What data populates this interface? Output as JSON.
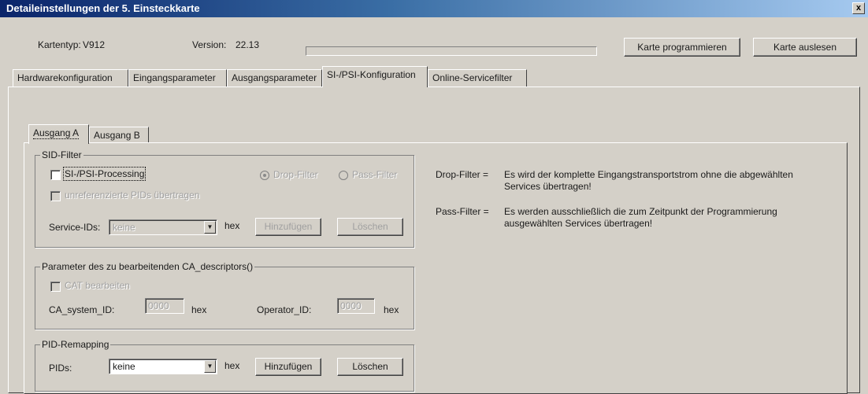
{
  "window": {
    "title": "Detaileinstellungen der 5. Einsteckkarte",
    "close_label": "x"
  },
  "header": {
    "kartentyp_label": "Kartentyp:",
    "kartentyp_value": "V912",
    "version_label": "Version:",
    "version_value": "22.13",
    "program_button": "Karte programmieren",
    "read_button": "Karte auslesen"
  },
  "main_tabs": [
    {
      "label": "Hardwarekonfiguration"
    },
    {
      "label": "Eingangsparameter"
    },
    {
      "label": "Ausgangsparameter"
    },
    {
      "label": "SI-/PSI-Konfiguration"
    },
    {
      "label": "Online-Servicefilter"
    }
  ],
  "sub_tabs": [
    {
      "label": "Ausgang A"
    },
    {
      "label": "Ausgang B"
    }
  ],
  "sid_filter": {
    "legend": "SID-Filter",
    "si_psi_processing": "SI-/PSI-Processing",
    "drop_filter": "Drop-Filter",
    "pass_filter": "Pass-Filter",
    "unreferenced_pids": "unreferenzierte PIDs übertragen",
    "service_ids_label": "Service-IDs:",
    "service_ids_value": "keine",
    "hex": "hex",
    "add_button": "Hinzufügen",
    "delete_button": "Löschen"
  },
  "ca_descriptor": {
    "legend": "Parameter des zu bearbeitenden CA_descriptors()",
    "cat_edit": "CAT bearbeiten",
    "ca_system_id_label": "CA_system_ID:",
    "ca_system_id_value": "0000",
    "operator_id_label": "Operator_ID:",
    "operator_id_value": "0000",
    "hex": "hex"
  },
  "pid_remapping": {
    "legend": "PID-Remapping",
    "pids_label": "PIDs:",
    "pids_value": "keine",
    "hex": "hex",
    "add_button": "Hinzufügen",
    "delete_button": "Löschen"
  },
  "help": {
    "drop_label": "Drop-Filter =",
    "drop_text_1": "Es wird der komplette Eingangstransportstrom ohne die abgewählten",
    "drop_text_2": "Services übertragen!",
    "pass_label": "Pass-Filter =",
    "pass_text_1": "Es werden ausschließlich die zum Zeitpunkt der Programmierung",
    "pass_text_2": "ausgewählten Services übertragen!"
  }
}
